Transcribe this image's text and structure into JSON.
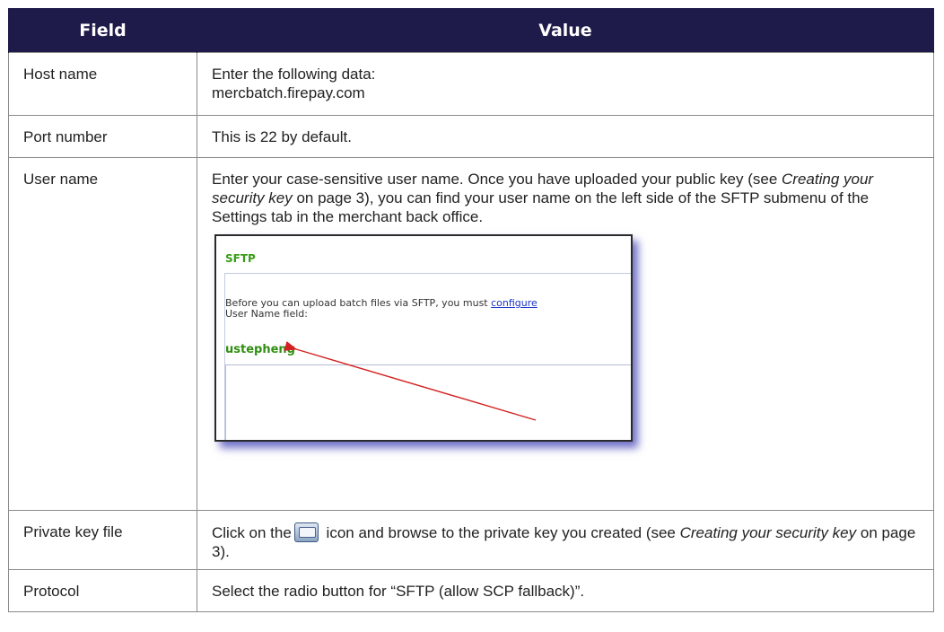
{
  "table": {
    "headers": [
      "Field",
      "Value"
    ],
    "rows": {
      "host": {
        "field": "Host name",
        "line1": "Enter the following data:",
        "line2": "mercbatch.firepay.com"
      },
      "port": {
        "field": "Port number",
        "value": "This is 22 by default."
      },
      "user": {
        "field": "User name",
        "text1": "Enter your case-sensitive user name. Once you have uploaded your public key (see ",
        "italic": "Creating your security key",
        "text2": " on page 3), you can find your user name on the left side of the SFTP submenu of the Settings tab in the merchant back office."
      },
      "key": {
        "field": "Private key file",
        "text1": "Click on the",
        "icon": "browse-button-icon",
        "text2": " icon and browse to the private key you created (see ",
        "italic": "Creating your security key",
        "text3": " on page 3)."
      },
      "protocol": {
        "field": "Protocol",
        "value": "Select the radio button for “SFTP (allow SCP fallback)”."
      }
    }
  },
  "screenshot": {
    "title": "SFTP",
    "text_pre": "Before you can upload batch files via SFTP, you must ",
    "link": "configure",
    "text_line2": "User Name field:",
    "username": "ustepheng",
    "arrow_color": "#d42020"
  }
}
